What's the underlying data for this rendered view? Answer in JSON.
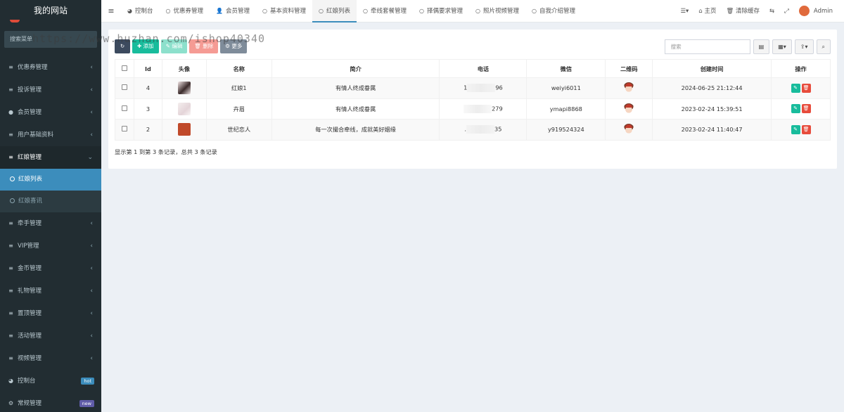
{
  "sidebar": {
    "site_name": "我的网站",
    "search_placeholder": "搜索菜单",
    "items": [
      {
        "label": "优惠券管理",
        "icon": "list-icon"
      },
      {
        "label": "投诉管理",
        "icon": "list-icon"
      },
      {
        "label": "会员管理",
        "icon": "user-circle-icon"
      },
      {
        "label": "用户基础资料",
        "icon": "list-icon"
      },
      {
        "label": "红娘管理",
        "icon": "list-icon"
      }
    ],
    "submenu": [
      {
        "label": "红娘列表",
        "active": true
      },
      {
        "label": "红娘喜讯",
        "active": false
      }
    ],
    "items_after": [
      {
        "label": "牵手管理",
        "icon": "list-icon"
      },
      {
        "label": "VIP管理",
        "icon": "list-icon"
      },
      {
        "label": "金币管理",
        "icon": "list-icon"
      },
      {
        "label": "礼物管理",
        "icon": "list-icon"
      },
      {
        "label": "置顶管理",
        "icon": "list-icon"
      },
      {
        "label": "活动管理",
        "icon": "list-icon"
      },
      {
        "label": "视频管理",
        "icon": "list-icon"
      },
      {
        "label": "控制台",
        "icon": "dashboard-icon",
        "badge": "hot"
      },
      {
        "label": "常规管理",
        "icon": "gear-icon",
        "badge": "new"
      }
    ]
  },
  "topbar": {
    "tabs": [
      {
        "label": "控制台",
        "icon": "dashboard-icon"
      },
      {
        "label": "优惠券管理",
        "icon": "circle-icon"
      },
      {
        "label": "会员管理",
        "icon": "user-icon"
      },
      {
        "label": "基本资料管理",
        "icon": "circle-icon"
      },
      {
        "label": "红娘列表",
        "icon": "circle-icon",
        "active": true
      },
      {
        "label": "牵线套餐管理",
        "icon": "circle-icon"
      },
      {
        "label": "择偶要求管理",
        "icon": "circle-icon"
      },
      {
        "label": "照片视频管理",
        "icon": "circle-icon"
      },
      {
        "label": "自我介绍管理",
        "icon": "circle-icon"
      }
    ],
    "right": {
      "home": "主页",
      "clear_cache": "清除缓存",
      "user": "Admin"
    }
  },
  "toolbar": {
    "add": "添加",
    "edit": "编辑",
    "delete": "删除",
    "more": "更多",
    "search_placeholder": "搜索"
  },
  "table": {
    "headers": [
      "Id",
      "头像",
      "名称",
      "简介",
      "电话",
      "微信",
      "二维码",
      "创建时间",
      "操作"
    ],
    "rows": [
      {
        "id": "4",
        "name": "红娘1",
        "intro": "有情人终成眷属",
        "phone_start": "1",
        "phone_end": "96",
        "wechat": "weiyi6011",
        "created": "2024-06-25 21:12:44"
      },
      {
        "id": "3",
        "name": "卉眉",
        "intro": "有情人终成眷属",
        "phone_start": "",
        "phone_end": "279",
        "wechat": "ymapi8868",
        "created": "2023-02-24 15:39:51"
      },
      {
        "id": "2",
        "name": "世纪恋人",
        "intro": "每一次撮合牵线，成就美好姻缘",
        "phone_start": ".",
        "phone_end": "35",
        "wechat": "y919524324",
        "created": "2023-02-24 11:40:47"
      }
    ],
    "pagination": "显示第 1 到第 3 条记录，总共 3 条记录"
  },
  "watermark": "https://www.huzhan.com/ishop40340",
  "colors": {
    "sidebar_bg": "#222d32",
    "active_blue": "#3c8dbc",
    "add_green": "#18bc9c",
    "delete_red": "#e74c3c"
  }
}
